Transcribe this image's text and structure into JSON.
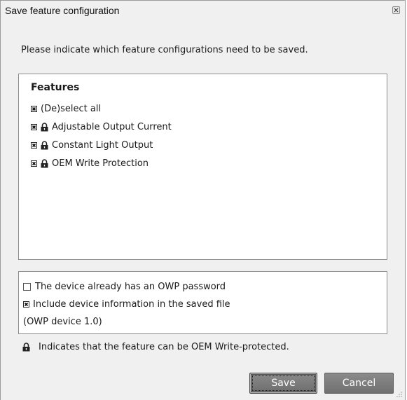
{
  "window": {
    "title": "Save feature configuration"
  },
  "intro_text": "Please indicate which feature configurations need to be saved.",
  "features": {
    "heading": "Features",
    "select_all": {
      "label": "(De)select all",
      "checked": true
    },
    "items": [
      {
        "label": "Adjustable Output Current",
        "checked": true,
        "locked": true
      },
      {
        "label": "Constant Light Output",
        "checked": true,
        "locked": true
      },
      {
        "label": "OEM Write Protection",
        "checked": true,
        "locked": true
      }
    ]
  },
  "options": {
    "owp_password": {
      "label": "The device already has an OWP password",
      "checked": false
    },
    "include_device_info": {
      "label": "Include device information in the saved file",
      "checked": true
    },
    "device_version": "(OWP device 1.0)"
  },
  "note": {
    "icon": "lock-icon",
    "text": "Indicates that the feature can be OEM Write-protected."
  },
  "buttons": {
    "save": "Save",
    "cancel": "Cancel"
  },
  "colors": {
    "dialog_bg": "#f0f0f0",
    "panel_bg": "#ffffff",
    "button_bg": "#7c7c7c",
    "button_text": "#ffffff"
  }
}
